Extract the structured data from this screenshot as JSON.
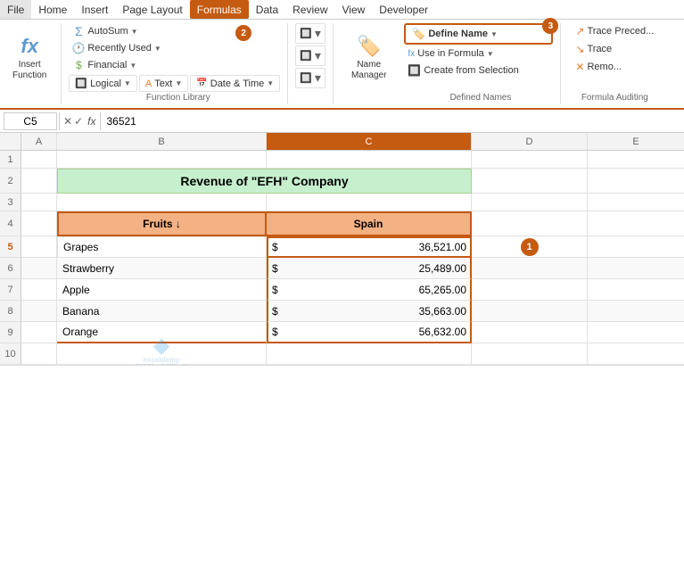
{
  "menubar": {
    "items": [
      "File",
      "Home",
      "Insert",
      "Page Layout",
      "Formulas",
      "Data",
      "Review",
      "View",
      "Developer"
    ]
  },
  "ribbon": {
    "active_tab": "Formulas",
    "groups": {
      "function_library": {
        "label": "Function Library",
        "insert_function": "Insert\nFunction",
        "autosum": "AutoSum",
        "recently_used": "Recently Used",
        "financial": "Financial",
        "logical": "Logical",
        "text": "Text",
        "date_time": "Date & Time"
      },
      "defined_names": {
        "label": "Defined Names",
        "name_manager": "Name\nManager",
        "define_name": "Define Name",
        "use_in_formula": "Use in Formula",
        "create_from_selection": "Create from Selection"
      },
      "formula_auditing": {
        "label": "Formula Auditing",
        "trace_precedents": "Trace\nPreced...",
        "trace_dependents": "Trace\nDepend...",
        "remove_arrows": "Remo..."
      }
    }
  },
  "formula_bar": {
    "cell_ref": "C5",
    "formula_value": "36521"
  },
  "spreadsheet": {
    "title": "Revenue of \"EFH\" Company",
    "headers": {
      "col_a": "A",
      "col_b": "B",
      "col_c": "C",
      "col_d": "D",
      "col_e": "E"
    },
    "row_headers": [
      "1",
      "2",
      "3",
      "4",
      "5",
      "6",
      "7",
      "8",
      "9",
      "10"
    ],
    "table": {
      "header_fruit": "Fruits ↓",
      "header_spain": "Spain",
      "rows": [
        {
          "fruit": "Grapes",
          "currency": "$",
          "amount": "36,521.00"
        },
        {
          "fruit": "Strawberry",
          "currency": "$",
          "amount": "25,489.00"
        },
        {
          "fruit": "Apple",
          "currency": "$",
          "amount": "65,265.00"
        },
        {
          "fruit": "Banana",
          "currency": "$",
          "amount": "35,663.00"
        },
        {
          "fruit": "Orange",
          "currency": "$",
          "amount": "56,632.00"
        }
      ]
    }
  },
  "badges": {
    "b1": "1",
    "b2": "2",
    "b3": "3"
  },
  "watermark": "exceldemy\nEXCEL · DATA · BI"
}
